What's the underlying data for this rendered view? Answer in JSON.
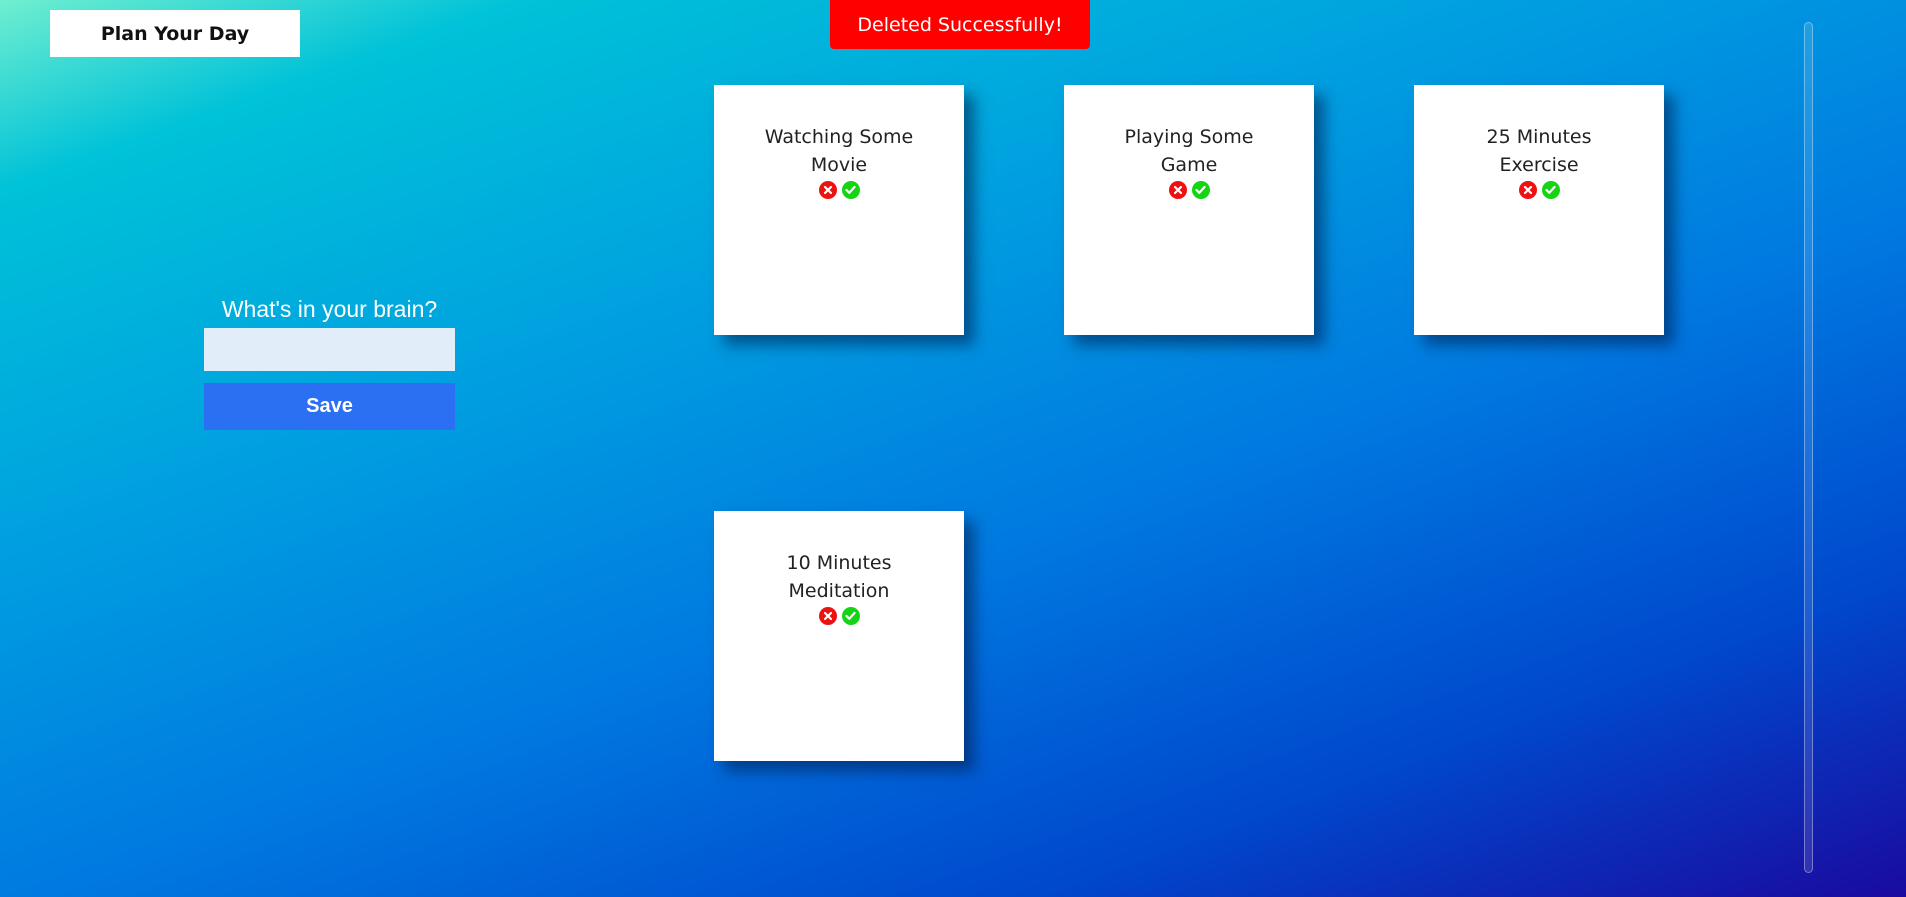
{
  "header": {
    "title": "Plan Your Day"
  },
  "toast": {
    "message": "Deleted Successfully!"
  },
  "entry": {
    "prompt": "What's in your brain?",
    "input_value": "",
    "save_label": "Save"
  },
  "cards": [
    {
      "text": "Watching Some Movie",
      "delete_icon": "close-circle-icon",
      "done_icon": "check-circle-icon"
    },
    {
      "text": "Playing Some Game",
      "delete_icon": "close-circle-icon",
      "done_icon": "check-circle-icon"
    },
    {
      "text": "25 Minutes Exercise",
      "delete_icon": "close-circle-icon",
      "done_icon": "check-circle-icon"
    },
    {
      "text": "10 Minutes Meditation",
      "delete_icon": "close-circle-icon",
      "done_icon": "check-circle-icon"
    }
  ],
  "colors": {
    "toast_bg": "#ff0000",
    "save_button": "#2b6ff2",
    "delete_icon": "#ee1111",
    "done_icon": "#14d414"
  }
}
